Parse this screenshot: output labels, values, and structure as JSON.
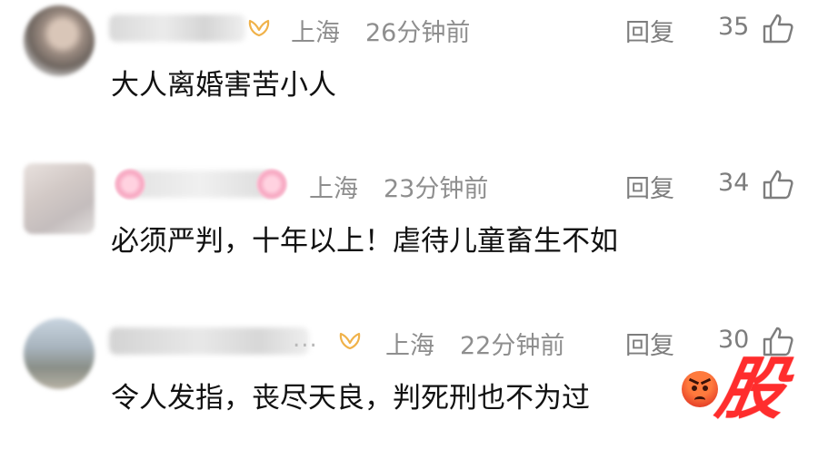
{
  "comments": [
    {
      "location": "上海",
      "time": "26分钟前",
      "reply_label": "回复",
      "likes": "35",
      "text": "大人离婚害苦小人"
    },
    {
      "location": "上海",
      "time": "23分钟前",
      "reply_label": "回复",
      "likes": "34",
      "text": "必须严判，十年以上！虐待儿童畜生不如"
    },
    {
      "location": "上海",
      "time": "22分钟前",
      "reply_label": "回复",
      "likes": "30",
      "text": "令人发指，丧尽天良，判死刑也不为过",
      "name_ellipsis": "..."
    }
  ],
  "watermark": "股",
  "icons": {
    "like": "thumbs-up-icon",
    "badge": "vip-wing-badge-icon",
    "emoji": "angry-face-emoji"
  },
  "colors": {
    "meta_text": "#8e8e8e",
    "content_text": "#111111",
    "badge": "#f0b24a",
    "watermark": "#ff2d2d",
    "background": "#ffffff"
  }
}
